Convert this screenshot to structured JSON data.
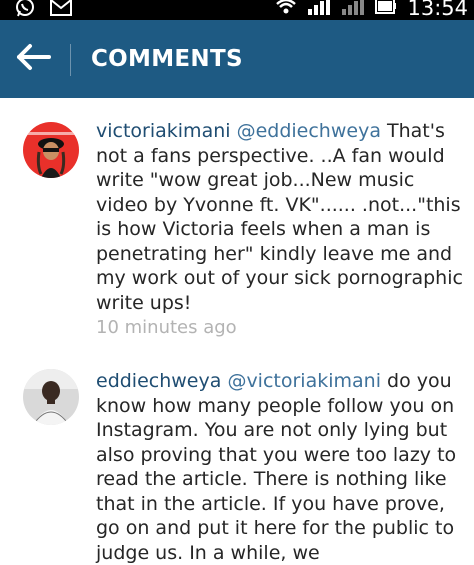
{
  "status_bar": {
    "time": "13:54",
    "icons": [
      "whatsapp-icon",
      "gmail-icon",
      "wifi-icon",
      "signal-icon",
      "signal-icon",
      "battery-icon"
    ]
  },
  "header": {
    "back_icon": "arrow-left-icon",
    "title": "COMMENTS",
    "bar_color": "#1e5a83"
  },
  "comments": [
    {
      "username": "victoriakimani",
      "mention": "@eddiechweya",
      "text": "That's not a fans perspective. ..A fan would write \"wow great job...New music video by Yvonne ft. VK\"...... .not...\"this is how Victoria feels when a man is penetrating her\" kindly leave me and my work  out of your sick pornographic write ups!",
      "timestamp": "10 minutes ago"
    },
    {
      "username": "eddiechweya",
      "mention": "@victoriakimani",
      "text": "do you know how many people follow you on Instagram. You are not only lying but also proving that you were too lazy to read the article. There is nothing like that in the article. If you have prove, go on and put it here for the public to judge us. In a while, we",
      "timestamp": ""
    }
  ]
}
